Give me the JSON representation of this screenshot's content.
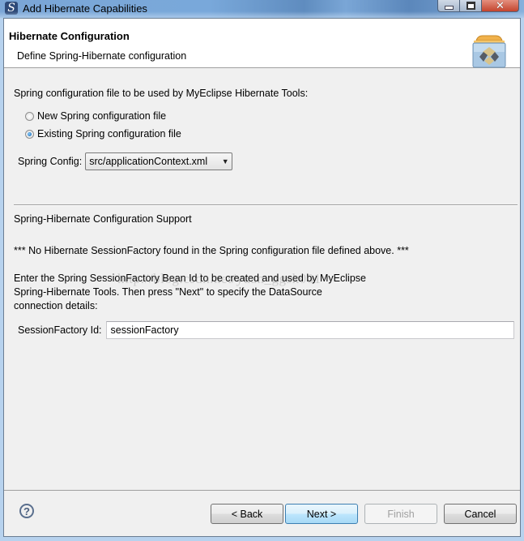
{
  "window": {
    "title": "Add Hibernate Capabilities",
    "icon": "myeclipse-s-icon",
    "controls": {
      "minimize": "minimize-icon",
      "maximize": "maximize-icon",
      "close": "close-icon"
    }
  },
  "banner": {
    "title": "Hibernate Configuration",
    "description": "Define Spring-Hibernate configuration",
    "icon": "hibernate-folder-icon"
  },
  "spring_file": {
    "label": "Spring configuration file to be used by MyEclipse Hibernate Tools:",
    "options": [
      {
        "label": "New Spring configuration file",
        "checked": false
      },
      {
        "label": "Existing Spring configuration file",
        "checked": true
      }
    ],
    "config_label": "Spring Config:",
    "config_value": "src/applicationContext.xml"
  },
  "support": {
    "heading": "Spring-Hibernate Configuration Support",
    "warning": "*** No Hibernate SessionFactory found in the Spring configuration file defined above. ***",
    "instructions": [
      "Enter the Spring SessionFactory Bean Id to be created and used by MyEclipse",
      "Spring-Hibernate Tools. Then press \"Next\" to specify the DataSource",
      "connection details:"
    ],
    "session_factory_label": "SessionFactory Id:",
    "session_factory_value": "sessionFactory",
    "watermark": "http://blog.csdn.net/yuan_ggsk001"
  },
  "footer": {
    "help_icon": "help-icon",
    "buttons": {
      "back": "< Back",
      "next": "Next >",
      "finish": "Finish",
      "cancel": "Cancel"
    }
  }
}
